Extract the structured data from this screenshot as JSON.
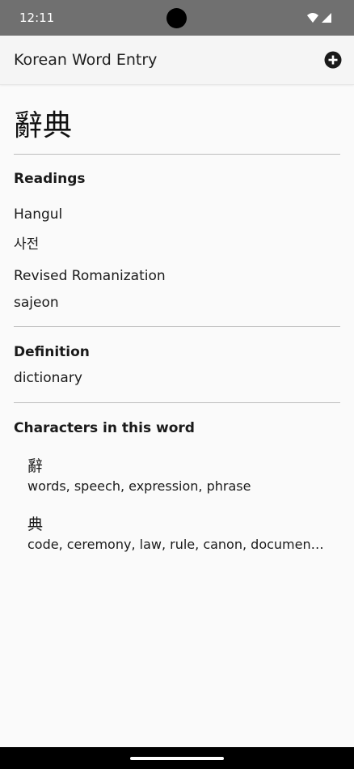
{
  "status_bar": {
    "time": "12:11"
  },
  "app_bar": {
    "title": "Korean Word Entry",
    "add_icon": "add-circle-icon"
  },
  "entry": {
    "headword": "辭典",
    "readings_title": "Readings",
    "hangul_label": "Hangul",
    "hangul_value": "사전",
    "romanization_label": "Revised Romanization",
    "romanization_value": "sajeon",
    "definition_title": "Definition",
    "definition_value": "dictionary",
    "characters_title": "Characters in this word",
    "characters": [
      {
        "char": "辭",
        "meaning": "words, speech, expression, phrase"
      },
      {
        "char": "典",
        "meaning": "code, ceremony, law, rule, canon, document…"
      }
    ]
  }
}
